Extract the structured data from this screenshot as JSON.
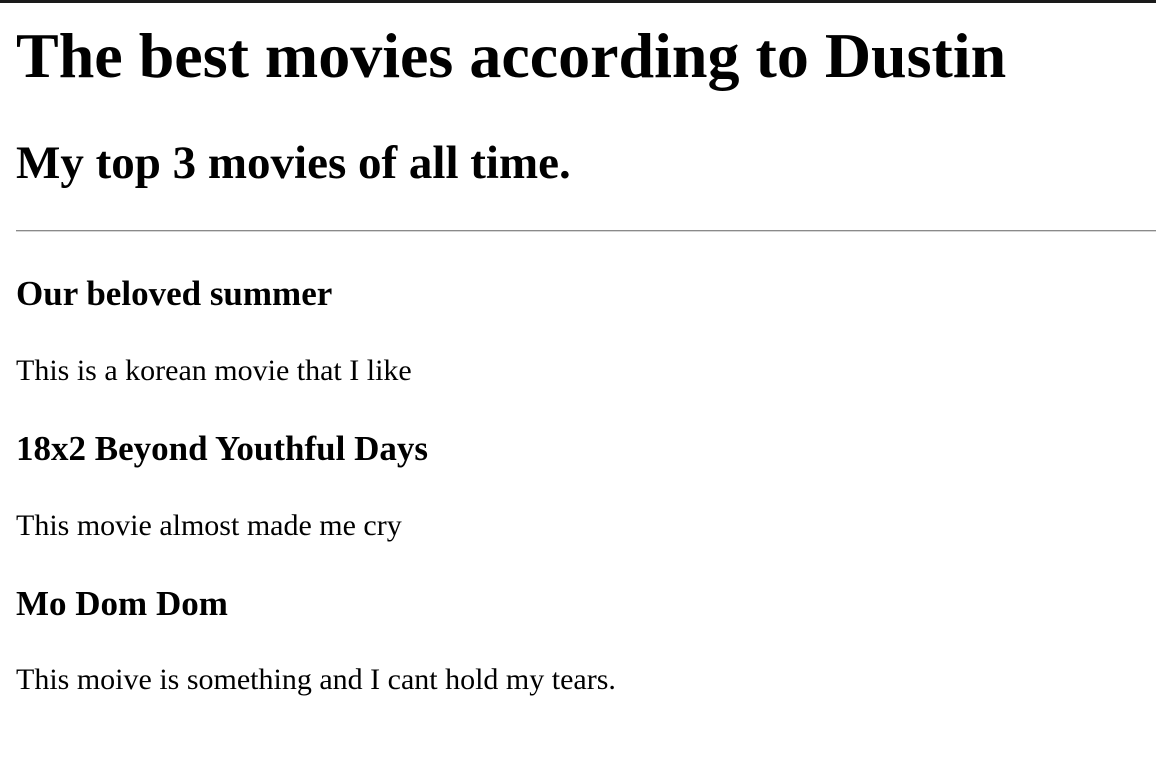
{
  "page": {
    "title": "The best movies according to Dustin",
    "subtitle": "My top 3 movies of all time."
  },
  "movies": [
    {
      "title": "Our beloved summer",
      "description": "This is a korean movie that I like"
    },
    {
      "title": "18x2 Beyond Youthful Days",
      "description": "This movie almost made me cry"
    },
    {
      "title": "Mo Dom Dom",
      "description": "This moive is something and I cant hold my tears."
    }
  ]
}
